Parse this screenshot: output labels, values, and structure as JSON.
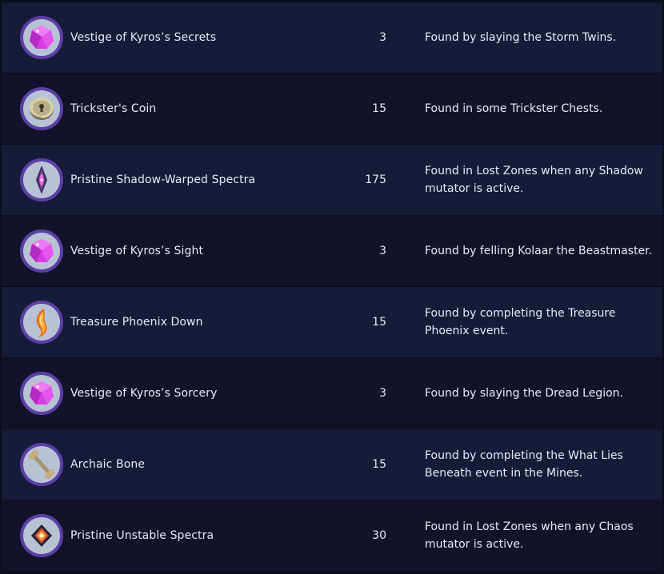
{
  "items": [
    {
      "name": "Vestige of Kyros’s Secrets",
      "qty": "3",
      "desc": "Found by slaying the Storm Twins.",
      "icon": "pink-crystal-icon"
    },
    {
      "name": "Trickster's Coin",
      "qty": "15",
      "desc": "Found in some Trickster Chests.",
      "icon": "coin-icon"
    },
    {
      "name": "Pristine Shadow-Warped Spectra",
      "qty": "175",
      "desc": "Found in Lost Zones when any Shadow mutator is active.",
      "icon": "shadow-spectra-icon"
    },
    {
      "name": "Vestige of Kyros’s Sight",
      "qty": "3",
      "desc": "Found by felling Kolaar the Beastmaster.",
      "icon": "pink-crystal-icon"
    },
    {
      "name": "Treasure Phoenix Down",
      "qty": "15",
      "desc": "Found by completing the Treasure Phoenix event.",
      "icon": "phoenix-feather-icon"
    },
    {
      "name": "Vestige of Kyros’s Sorcery",
      "qty": "3",
      "desc": "Found by slaying the Dread Legion.",
      "icon": "pink-crystal-icon"
    },
    {
      "name": "Archaic Bone",
      "qty": "15",
      "desc": "Found by completing the What Lies Beneath event in the Mines.",
      "icon": "bone-icon"
    },
    {
      "name": "Pristine Unstable Spectra",
      "qty": "30",
      "desc": "Found in Lost Zones when any Chaos mutator is active.",
      "icon": "unstable-spectra-icon"
    }
  ]
}
